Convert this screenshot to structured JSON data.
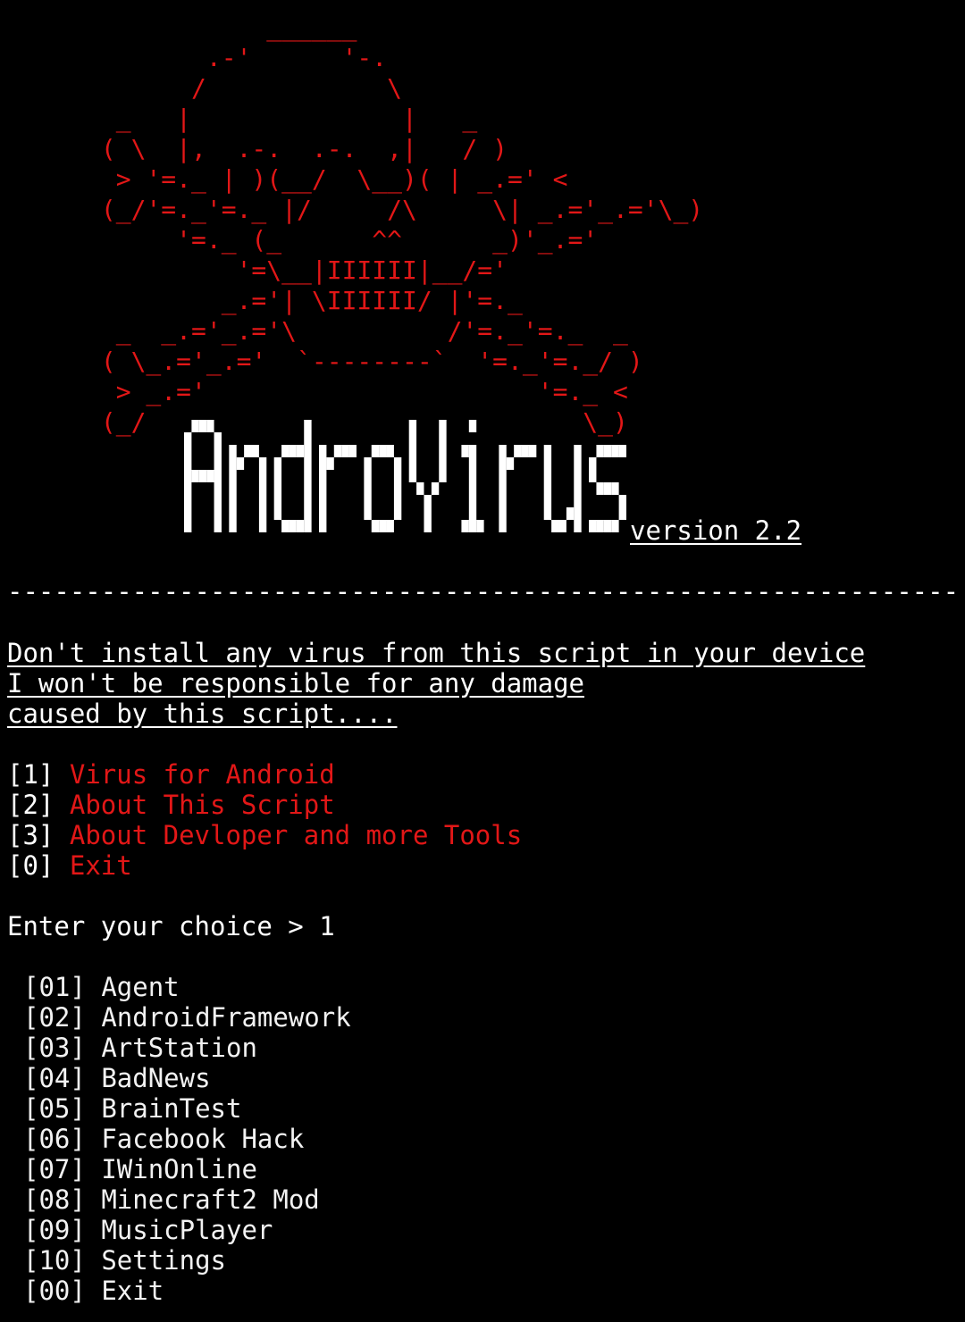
{
  "skull_art": "            ______\n        .-'      '-.\n       /            \\\n  _   |              |   _\n ( \\  |,  .-.  .-.  ,|   / )\n  > '=._ | )(__/  \\__)( | _.=' <\n (_/'=._'=._ |/     /\\     \\| _.='_.='\\_)\n      '=._ (_      ^^      _)'_.='\n          '=\\__|IIIIII|__/='\n         _.='| \\IIIIII/ |'=._\n  _  _.='_.='\\          /'=._'=._  _\n ( \\_.='_.='  `--------`  '=._'=._/ )\n  > _.='                      '=._ <\n (_/                             \\_)",
  "title": "AndroVirus",
  "version": "version 2.2",
  "separator": "-------------------------------------------------------------",
  "warning": {
    "line1": "Don't install any virus from this script in your device",
    "line2": "I won't be responsible for any damage",
    "line3": "caused by this script...."
  },
  "main_menu": [
    {
      "key": "[1]",
      "label": "Virus for Android"
    },
    {
      "key": "[2]",
      "label": "About This Script"
    },
    {
      "key": "[3]",
      "label": "About Devloper and more Tools"
    },
    {
      "key": "[0]",
      "label": "Exit"
    }
  ],
  "prompt": "Enter your choice > 1",
  "virus_list": [
    {
      "key": "[01]",
      "label": "Agent"
    },
    {
      "key": "[02]",
      "label": "AndroidFramework"
    },
    {
      "key": "[03]",
      "label": "ArtStation"
    },
    {
      "key": "[04]",
      "label": "BadNews"
    },
    {
      "key": "[05]",
      "label": "BrainTest"
    },
    {
      "key": "[06]",
      "label": "Facebook Hack"
    },
    {
      "key": "[07]",
      "label": "IWinOnline"
    },
    {
      "key": "[08]",
      "label": "Minecraft2 Mod"
    },
    {
      "key": "[09]",
      "label": "MusicPlayer"
    },
    {
      "key": "[10]",
      "label": "Settings"
    },
    {
      "key": "[00]",
      "label": "Exit"
    }
  ],
  "colors": {
    "background": "#000000",
    "text": "#f0f0f0",
    "accent_red": "#e21717"
  }
}
